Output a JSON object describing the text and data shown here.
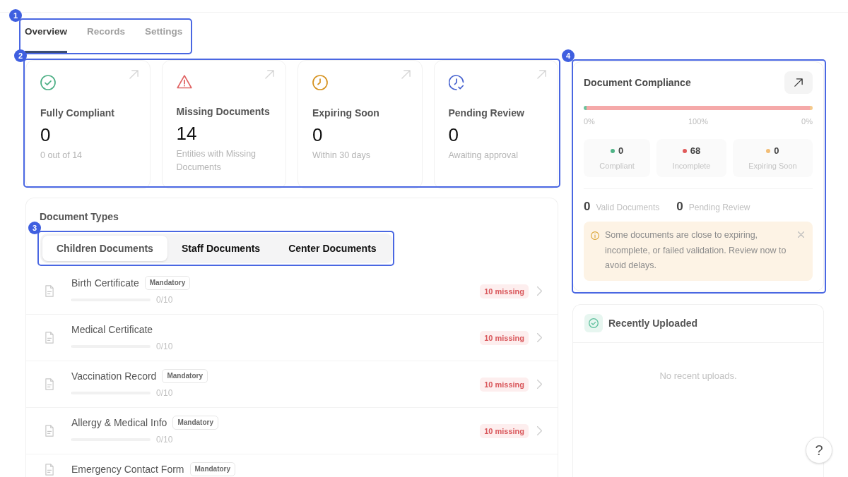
{
  "nav": {
    "annotation": "1",
    "tabs": [
      {
        "label": "Overview",
        "selected": true
      },
      {
        "label": "Records",
        "selected": false
      },
      {
        "label": "Settings",
        "selected": false
      }
    ]
  },
  "stat_cards": {
    "annotation": "2",
    "cards": [
      {
        "kind": "compliant",
        "title": "Fully Compliant",
        "value": "0",
        "subtitle": "0 out of 14"
      },
      {
        "kind": "missing",
        "title": "Missing Documents",
        "value": "14",
        "subtitle": "Entities with Missing Documents"
      },
      {
        "kind": "expiring",
        "title": "Expiring Soon",
        "value": "0",
        "subtitle": "Within 30 days"
      },
      {
        "kind": "pending",
        "title": "Pending Review",
        "value": "0",
        "subtitle": "Awaiting approval"
      }
    ]
  },
  "document_types": {
    "title": "Document Types",
    "filter": {
      "annotation": "3",
      "tabs": [
        {
          "label": "Children Documents",
          "selected": true
        },
        {
          "label": "Staff Documents",
          "selected": false
        },
        {
          "label": "Center Documents",
          "selected": false
        }
      ]
    },
    "rows": [
      {
        "name": "Birth Certificate",
        "tag": "Mandatory",
        "level": 0,
        "progress": "0/10",
        "missing": "10 missing"
      },
      {
        "name": "Medical Certificate",
        "level": 0,
        "progress": "0/10",
        "missing": "10 missing"
      },
      {
        "name": "Vaccination Record",
        "tag": "Mandatory",
        "level": 0,
        "progress": "0/10",
        "missing": "10 missing"
      },
      {
        "name": "Allergy & Medical Info",
        "tag": "Mandatory",
        "level": 0,
        "progress": "0/10",
        "missing": "10 missing"
      },
      {
        "name": "Emergency Contact Form",
        "tag": "Mandatory"
      }
    ]
  },
  "compliance": {
    "annotation": "4",
    "title": "Document Compliance",
    "segments": [
      {
        "level": 0,
        "color": "#6cc39c"
      },
      {
        "level": 1,
        "color": "#f5a9a9"
      },
      {
        "level": 0,
        "color": "#f5c98c"
      }
    ],
    "percent_labels": [
      "0%",
      "100%",
      "0%"
    ],
    "stats": [
      {
        "value": "0",
        "label": "Compliant",
        "color": "#4fb386"
      },
      {
        "value": "68",
        "label": "Incomplete",
        "color": "#e05a5a"
      },
      {
        "value": "0",
        "label": "Expiring Soon",
        "color": "#f2bd76"
      }
    ],
    "totals": [
      {
        "value": "0",
        "label": "Valid Documents"
      },
      {
        "value": "0",
        "label": "Pending Review"
      }
    ],
    "alert": {
      "text": "Some documents are close to expiring, incomplete, or failed validation. Review now to avoid delays.",
      "dismissible": true
    }
  },
  "recent_uploads": {
    "title": "Recently Uploaded",
    "empty_text": "No recent uploads."
  },
  "help_button": {
    "label": "?"
  }
}
